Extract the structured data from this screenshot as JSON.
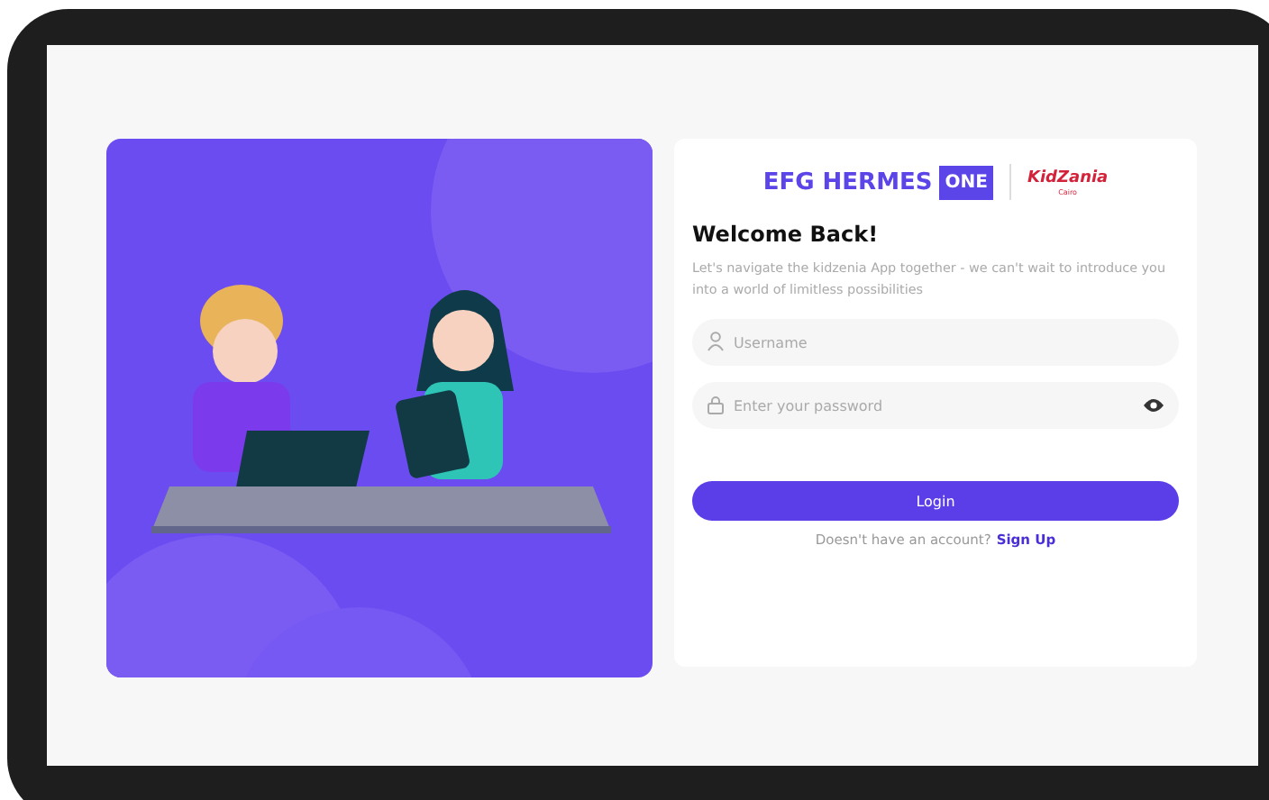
{
  "brand": {
    "name": "EFG HERMES",
    "badge": "ONE",
    "partner": "KidZania",
    "partner_city": "Cairo"
  },
  "heading": "Welcome Back!",
  "intro": "Let's navigate the kidzenia App together - we can't wait to introduce you into a world of limitless possibilities",
  "username": {
    "placeholder": "Username"
  },
  "password": {
    "placeholder": "Enter your password"
  },
  "login_button": "Login",
  "signup": {
    "prompt": "Doesn't have an account?",
    "link": "Sign Up"
  }
}
